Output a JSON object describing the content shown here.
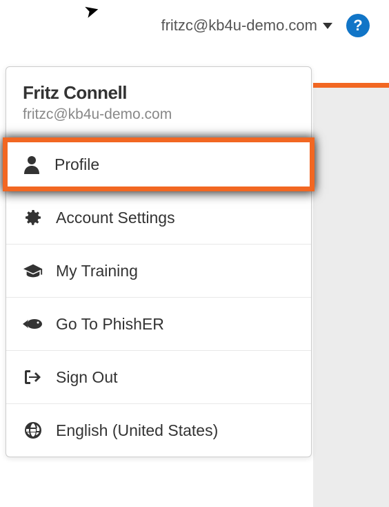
{
  "header": {
    "email": "fritzc@kb4u-demo.com",
    "help_symbol": "?"
  },
  "user": {
    "name": "Fritz Connell",
    "email": "fritzc@kb4u-demo.com"
  },
  "menu": {
    "profile": "Profile",
    "account_settings": "Account Settings",
    "my_training": "My Training",
    "go_to_phisher": "Go To PhishER",
    "sign_out": "Sign Out",
    "language": "English (United States)"
  },
  "colors": {
    "accent": "#f26722",
    "help_bg": "#1175c7"
  }
}
